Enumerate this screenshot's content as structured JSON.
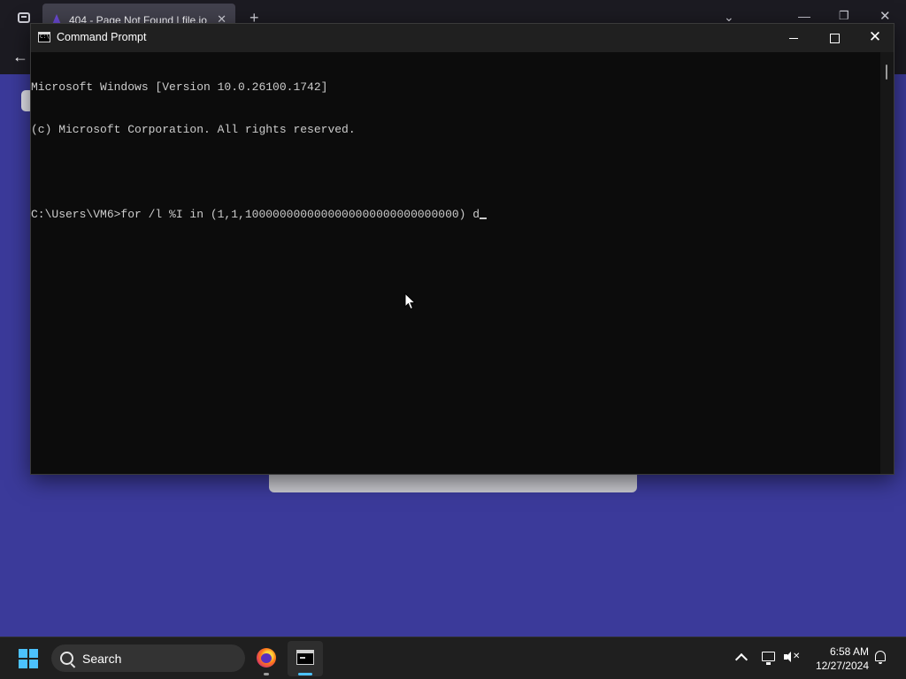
{
  "browser": {
    "tab_title": "404 - Page Not Found | file.io",
    "tab_close": "✕",
    "new_tab": "+",
    "list_all_tabs": "⌄",
    "minimize": "—",
    "restore": "❐",
    "close": "✕",
    "back": "←"
  },
  "cmd": {
    "window_title": "Command Prompt",
    "close_glyph": "✕",
    "lines": [
      "Microsoft Windows [Version 10.0.26100.1742]",
      "(c) Microsoft Corporation. All rights reserved.",
      "",
      "C:\\Users\\VM6>for /l %I in (1,1,1000000000000000000000000000000) d"
    ]
  },
  "taskbar": {
    "search_label": "Search",
    "time": "6:58 AM",
    "date": "12/27/2024",
    "pinned_apps": [
      {
        "name": "Firefox",
        "icon": "firefox-icon",
        "active": false
      },
      {
        "name": "Command Prompt",
        "icon": "command-prompt-icon",
        "active": true
      }
    ]
  },
  "colors": {
    "desktop_page_bg": "#3b3a9a",
    "console_bg": "#0c0c0c",
    "console_text": "#cccccc",
    "taskbar_bg": "#1f1f1f",
    "accent": "#4cc2ff"
  }
}
